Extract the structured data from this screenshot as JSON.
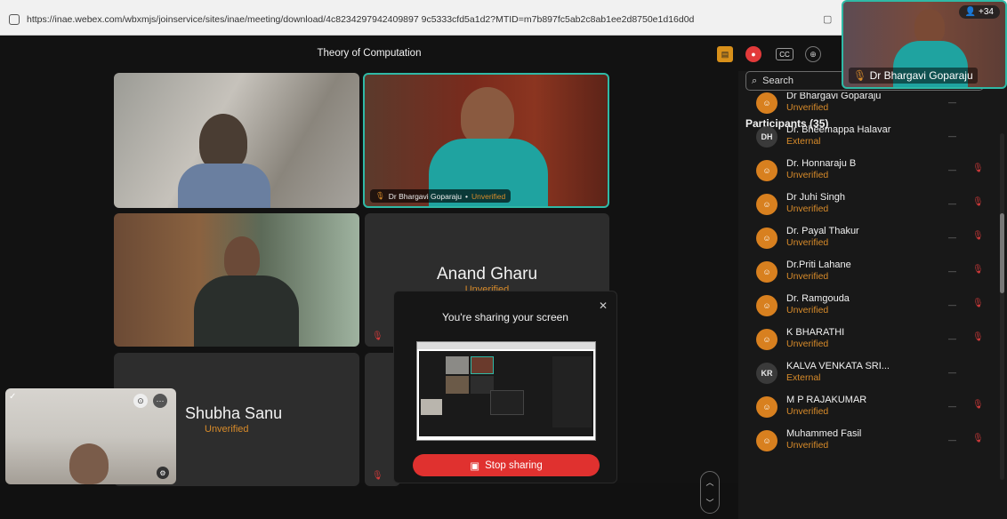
{
  "browser": {
    "url": "https://inae.webex.com/wbxmjs/joinservice/sites/inae/meeting/download/4c8234297942409897 9c5333cfd5a1d2?MTID=m7b897fc5ab2c8ab1ee2d8750e1d16d0d"
  },
  "meeting": {
    "title": "Theory of Computation"
  },
  "tiles": {
    "presenter_name": "Dr Bhargavi Goparaju",
    "presenter_status": "Unverified",
    "anand_name": "Anand Gharu",
    "anand_status": "Unverified",
    "shubha_name": "Shubha Sanu",
    "shubha_status": "Unverified"
  },
  "share_modal": {
    "title": "You're sharing your screen",
    "stop_label": "Stop sharing"
  },
  "panel": {
    "title": "Participants (35)",
    "search_placeholder": "Search",
    "participants": [
      {
        "name": "Dr Bhargavi Goparaju",
        "status": "Unverified",
        "avatar": "user"
      },
      {
        "name": "Dr. Bheemappa Halavar",
        "status": "External",
        "avatar": "DH"
      },
      {
        "name": "Dr. Honnaraju B",
        "status": "Unverified",
        "avatar": "user"
      },
      {
        "name": "Dr Juhi Singh",
        "status": "Unverified",
        "avatar": "user"
      },
      {
        "name": "Dr. Payal Thakur",
        "status": "Unverified",
        "avatar": "user"
      },
      {
        "name": "Dr.Priti Lahane",
        "status": "Unverified",
        "avatar": "user"
      },
      {
        "name": "Dr. Ramgouda",
        "status": "Unverified",
        "avatar": "user"
      },
      {
        "name": "K BHARATHI",
        "status": "Unverified",
        "avatar": "user"
      },
      {
        "name": "KALVA VENKATA SRI...",
        "status": "External",
        "avatar": "KR"
      },
      {
        "name": "M P RAJAKUMAR",
        "status": "Unverified",
        "avatar": "user"
      },
      {
        "name": "Muhammed Fasil",
        "status": "Unverified",
        "avatar": "user"
      }
    ]
  },
  "floating_cam": {
    "name": "Dr Bhargavi Goparaju",
    "count": "+34"
  },
  "colors": {
    "accent": "#2fb9a6",
    "unverified": "#d88b2a",
    "stop": "#e0312f"
  }
}
